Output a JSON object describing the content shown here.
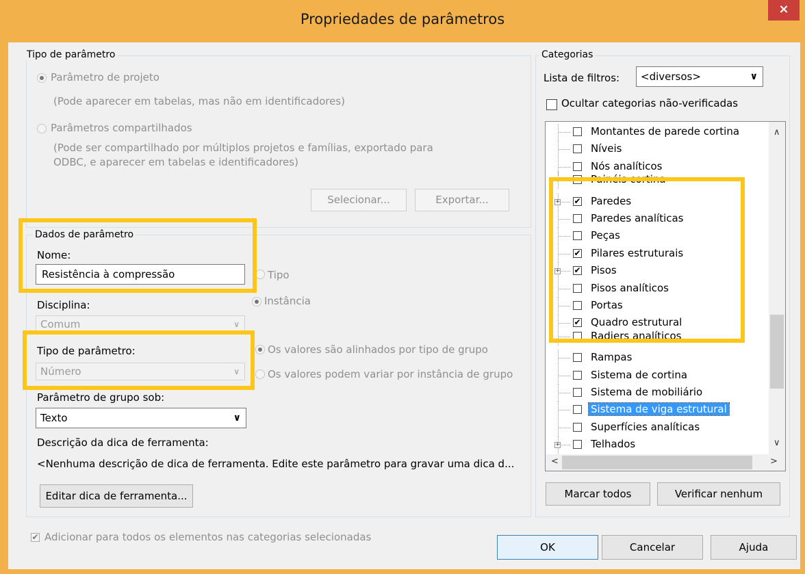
{
  "window": {
    "title": "Propriedades de parâmetros",
    "close_glyph": "×"
  },
  "param_type_group": {
    "title": "Tipo de parâmetro",
    "project_param": {
      "label": "Parâmetro de projeto",
      "note": "(Pode aparecer em tabelas, mas não em identificadores)"
    },
    "shared_param": {
      "label": "Parâmetros compartilhados",
      "note_line1": "(Pode ser compartilhado por múltiplos projetos e famílias, exportado para",
      "note_line2": "ODBC, e aparecer em tabelas e identificadores)"
    },
    "select_button": "Selecionar...",
    "export_button": "Exportar..."
  },
  "param_data_group": {
    "title": "Dados de parâmetro",
    "name_label": "Nome:",
    "name_value": "Resistência à compressão",
    "type_radio": "Tipo",
    "instance_radio": "Instância",
    "discipline_label": "Disciplina:",
    "discipline_value": "Comum",
    "param_type_label": "Tipo de parâmetro:",
    "param_type_value": "Número",
    "aligned_radio": "Os valores são alinhados por tipo de grupo",
    "vary_radio": "Os valores podem variar por instância de grupo",
    "group_under_label": "Parâmetro de grupo sob:",
    "group_under_value": "Texto",
    "tooltip_label": "Descrição da dica de ferramenta:",
    "tooltip_text": "<Nenhuma descrição de dica de ferramenta. Edite este parâmetro para gravar uma dica d...",
    "edit_tooltip_button": "Editar dica de ferramenta..."
  },
  "categories_group": {
    "title": "Categorias",
    "filter_label": "Lista de filtros:",
    "filter_value": "<diversos>",
    "hide_unchecked_label": "Ocultar categorias não-verificadas",
    "items": [
      {
        "label": "Montantes de parede cortina",
        "checked": ""
      },
      {
        "label": "Níveis",
        "checked": ""
      },
      {
        "label": "Nós analíticos",
        "checked": ""
      },
      {
        "label": "Painéis cortina",
        "checked": ""
      },
      {
        "label": "Paredes",
        "checked": "✔"
      },
      {
        "label": "Paredes analíticas",
        "checked": ""
      },
      {
        "label": "Peças",
        "checked": ""
      },
      {
        "label": "Pilares estruturais",
        "checked": "✔"
      },
      {
        "label": "Pisos",
        "checked": "✔"
      },
      {
        "label": "Pisos analíticos",
        "checked": ""
      },
      {
        "label": "Portas",
        "checked": ""
      },
      {
        "label": "Quadro estrutural",
        "checked": "✔"
      },
      {
        "label": "Radiers analíticos",
        "checked": ""
      },
      {
        "label": "Rampas",
        "checked": ""
      },
      {
        "label": "Sistema de cortina",
        "checked": ""
      },
      {
        "label": "Sistema de mobiliário",
        "checked": ""
      },
      {
        "label": "Sistema de viga estrutural",
        "checked": ""
      },
      {
        "label": "Superfícies analíticas",
        "checked": ""
      },
      {
        "label": "Telhados",
        "checked": ""
      }
    ],
    "check_all_button": "Marcar todos",
    "check_none_button": "Verificar nenhum"
  },
  "add_to_all": {
    "label": "Adicionar para todos os elementos nas categorias selecionadas",
    "checked": "✔"
  },
  "footer": {
    "ok": "OK",
    "cancel": "Cancelar",
    "help": "Ajuda"
  },
  "colors": {
    "frame": "#f2b14a",
    "highlight": "#ffc61a",
    "selection": "#3399ff",
    "close": "#c9403a"
  }
}
